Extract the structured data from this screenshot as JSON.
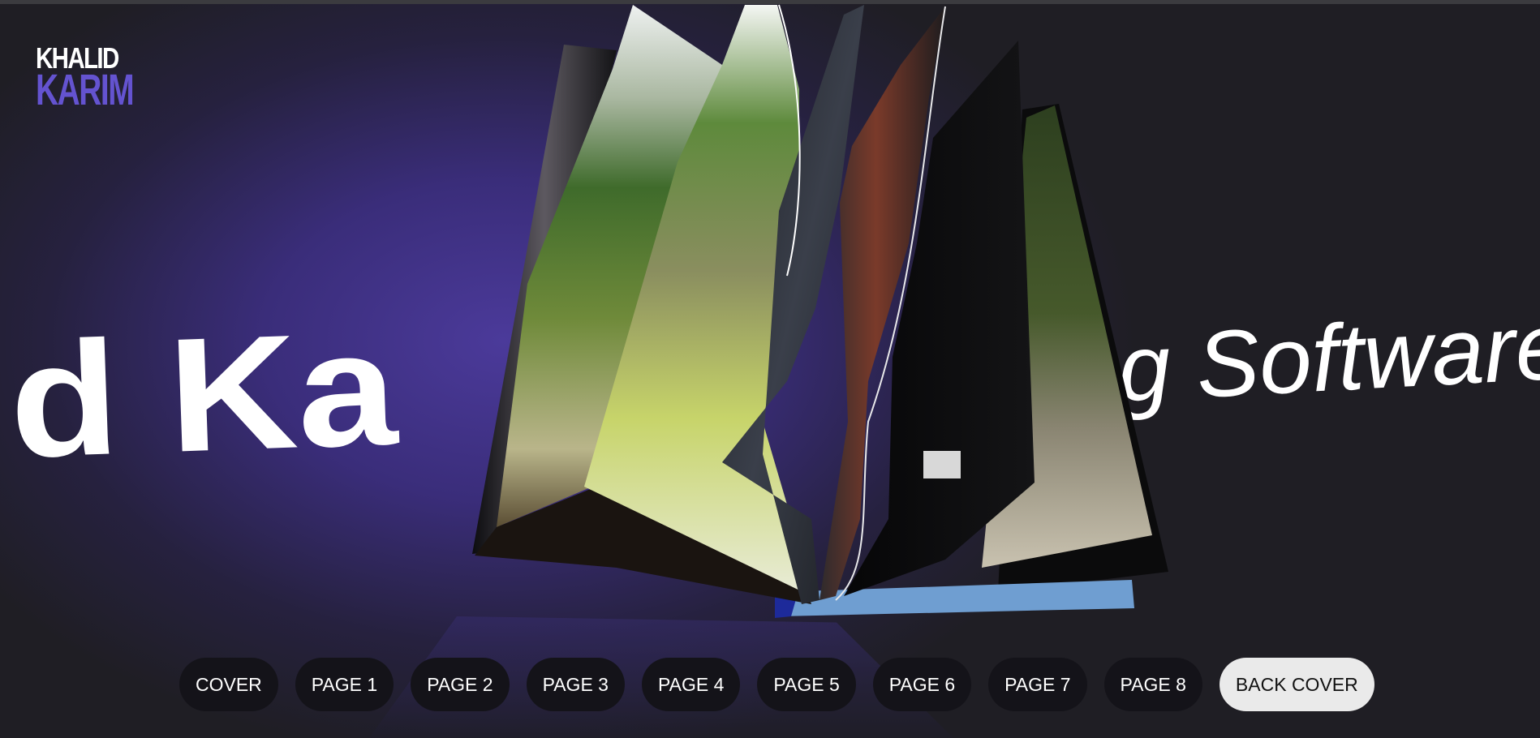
{
  "logo": {
    "line1": "KHALID",
    "line2": "KARIM"
  },
  "hero": {
    "left_text": "lid Ka",
    "right_text": "g Software"
  },
  "nav": {
    "items": [
      {
        "label": "COVER",
        "active": false
      },
      {
        "label": "PAGE 1",
        "active": false
      },
      {
        "label": "PAGE 2",
        "active": false
      },
      {
        "label": "PAGE 3",
        "active": false
      },
      {
        "label": "PAGE 4",
        "active": false
      },
      {
        "label": "PAGE 5",
        "active": false
      },
      {
        "label": "PAGE 6",
        "active": false
      },
      {
        "label": "PAGE 7",
        "active": false
      },
      {
        "label": "PAGE 8",
        "active": false
      },
      {
        "label": "BACK COVER",
        "active": true
      }
    ]
  },
  "colors": {
    "accent": "#6453d0",
    "background": "#4b3a9a",
    "active_button": "#eaeaea"
  }
}
